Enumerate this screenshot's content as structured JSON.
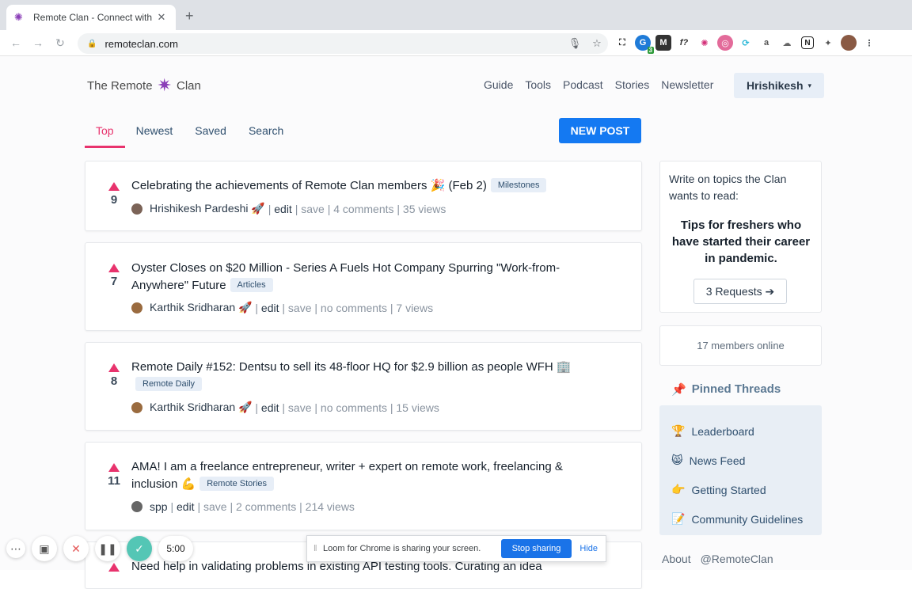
{
  "browser": {
    "tab_title": "Remote Clan - Connect with re",
    "url": "remoteclan.com",
    "ext_badge_count": "3"
  },
  "site": {
    "logo_left": "The Remote",
    "logo_right": "Clan",
    "nav": [
      "Guide",
      "Tools",
      "Podcast",
      "Stories",
      "Newsletter"
    ],
    "user_name": "Hrishikesh",
    "tabs": [
      "Top",
      "Newest",
      "Saved",
      "Search"
    ],
    "active_tab": "Top",
    "new_post_label": "NEW POST"
  },
  "posts": [
    {
      "votes": "9",
      "title": "Celebrating the achievements of Remote Clan members 🎉 (Feb 2)",
      "tag": "Milestones",
      "author": "Hrishikesh Pardeshi 🚀",
      "edit": "edit",
      "save": "save",
      "comments": "4 comments",
      "views": "35 views"
    },
    {
      "votes": "7",
      "title": "Oyster Closes on $20 Million - Series A Fuels Hot Company Spurring \"Work-from-Anywhere\" Future",
      "tag": "Articles",
      "author": "Karthik Sridharan 🚀",
      "edit": "edit",
      "save": "save",
      "comments": "no comments",
      "views": "7 views"
    },
    {
      "votes": "8",
      "title": "Remote Daily #152: Dentsu to sell its 48-floor HQ for $2.9 billion as people WFH 🏢",
      "tag": "Remote Daily",
      "author": "Karthik Sridharan 🚀",
      "edit": "edit",
      "save": "save",
      "comments": "no comments",
      "views": "15 views"
    },
    {
      "votes": "11",
      "title": "AMA! I am a freelance entrepreneur, writer + expert on remote work, freelancing & inclusion 💪",
      "tag": "Remote Stories",
      "author": "spp",
      "edit": "edit",
      "save": "save",
      "comments": "2 comments",
      "views": "214 views"
    },
    {
      "title": "Need help in validating problems in existing API testing tools. Curating an idea"
    }
  ],
  "sidebar": {
    "intro": "Write on topics the Clan wants to read:",
    "topic": "Tips for freshers who have started their career in pandemic.",
    "requests_button": "3 Requests ➔",
    "online": "17 members online",
    "pinned_title": "Pinned Threads",
    "pinned": [
      {
        "icon": "🏆",
        "label": "Leaderboard"
      },
      {
        "icon": "😸",
        "label": "News Feed"
      },
      {
        "icon": "👉",
        "label": "Getting Started"
      },
      {
        "icon": "📝",
        "label": "Community Guidelines"
      }
    ],
    "footer": [
      "About",
      "@RemoteClan"
    ]
  },
  "loom": {
    "timer": "5:00",
    "message": "Loom for Chrome is sharing your screen.",
    "stop_label": "Stop sharing",
    "hide_label": "Hide"
  }
}
